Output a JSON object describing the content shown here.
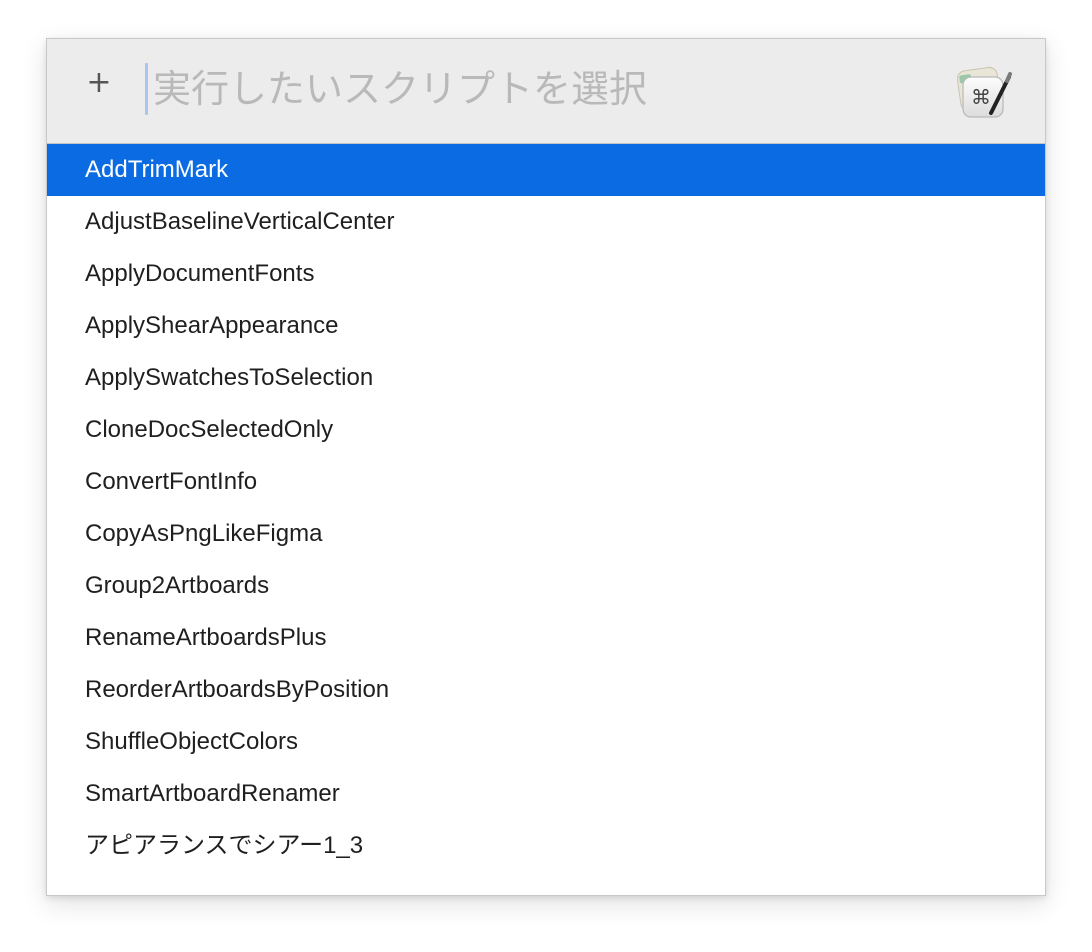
{
  "toolbar": {
    "add_icon": "plus-icon",
    "add_label": "+",
    "app_icon": "command-pen-app-icon"
  },
  "search": {
    "placeholder": "実行したいスクリプトを選択",
    "value": ""
  },
  "colors": {
    "selection": "#0a6be3",
    "header_bg": "#ececec",
    "text": "#1f1f1f",
    "placeholder": "#b9b9b9"
  },
  "list": {
    "selected_index": 0,
    "items": [
      "AddTrimMark",
      "AdjustBaselineVerticalCenter",
      "ApplyDocumentFonts",
      "ApplyShearAppearance",
      "ApplySwatchesToSelection",
      "CloneDocSelectedOnly",
      "ConvertFontInfo",
      "CopyAsPngLikeFigma",
      "Group2Artboards",
      "RenameArtboardsPlus",
      "ReorderArtboardsByPosition",
      "ShuffleObjectColors",
      "SmartArtboardRenamer",
      "アピアランスでシアー1_3"
    ]
  }
}
